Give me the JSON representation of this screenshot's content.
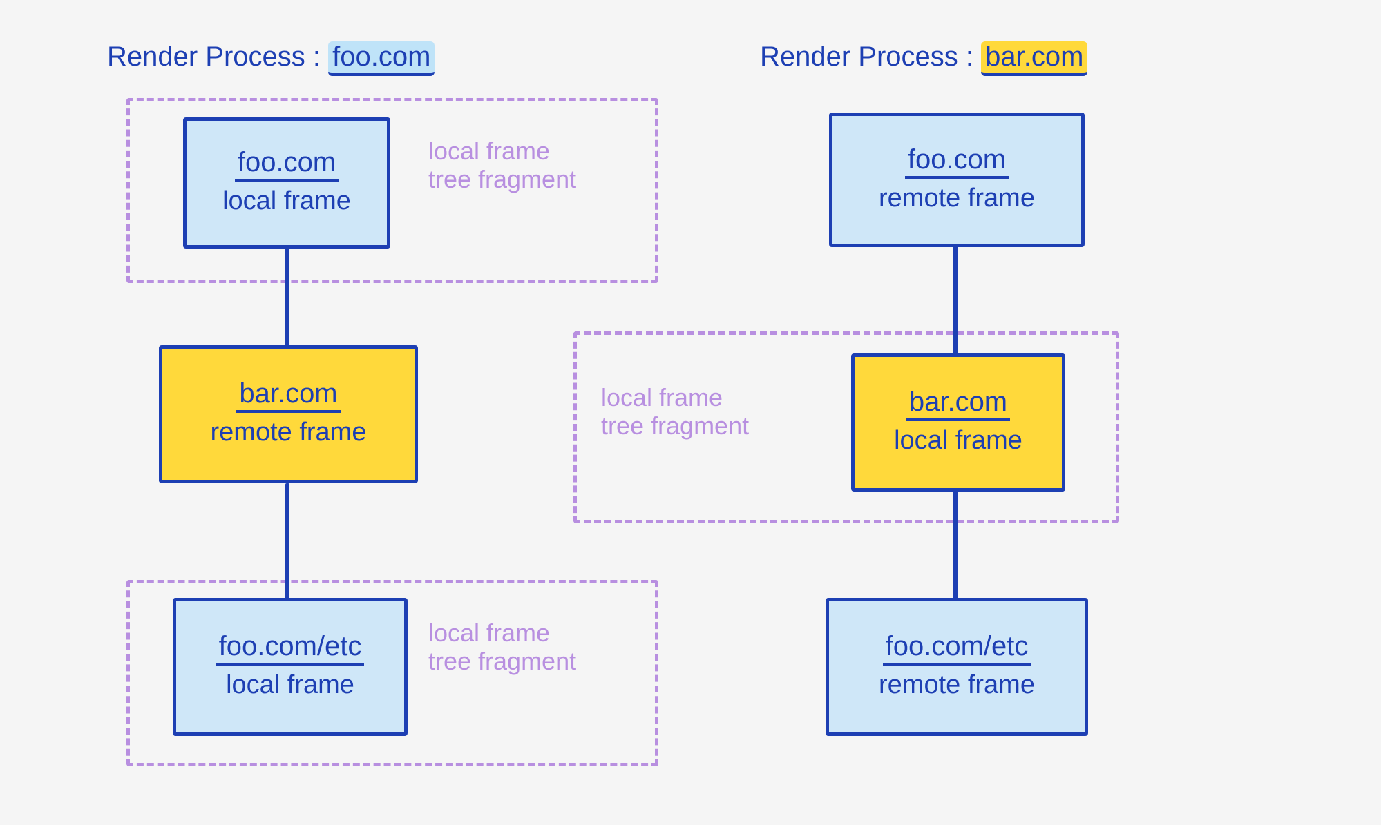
{
  "colors": {
    "ink": "#1d3fb3",
    "fragment": "#b88fe0",
    "fill_blue": "#cfe7f8",
    "fill_yellow": "#ffd93b",
    "hl_blue": "#bfe3f8",
    "hl_yellow": "#ffd93b",
    "background": "#f5f5f5"
  },
  "left": {
    "title_prefix": "Render Process : ",
    "title_origin": "foo.com",
    "nodes": [
      {
        "url": "foo.com",
        "type": "local frame",
        "fill": "blue"
      },
      {
        "url": "bar.com",
        "type": "remote frame",
        "fill": "yellow"
      },
      {
        "url": "foo.com/etc",
        "type": "local frame",
        "fill": "blue"
      }
    ],
    "fragment_label": "local frame\ntree fragment"
  },
  "right": {
    "title_prefix": "Render Process : ",
    "title_origin": "bar.com",
    "nodes": [
      {
        "url": "foo.com",
        "type": "remote frame",
        "fill": "blue"
      },
      {
        "url": "bar.com",
        "type": "local frame",
        "fill": "yellow"
      },
      {
        "url": "foo.com/etc",
        "type": "remote frame",
        "fill": "blue"
      }
    ],
    "fragment_label": "local frame\ntree fragment"
  }
}
